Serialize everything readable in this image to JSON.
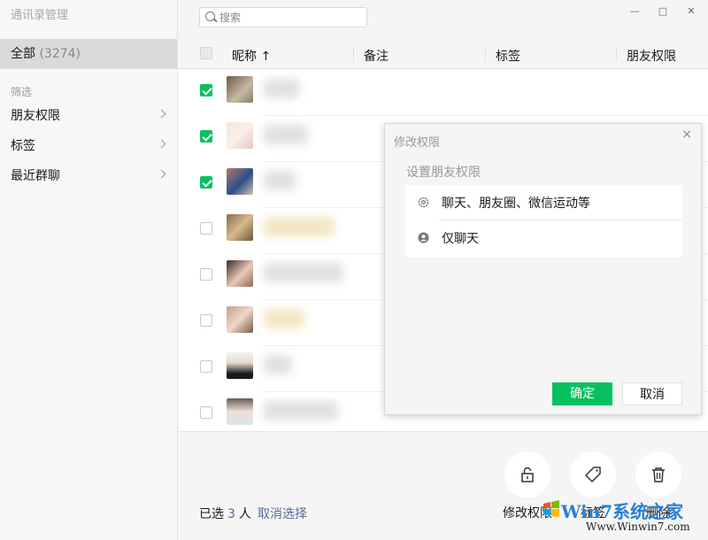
{
  "app": {
    "title": "通讯录管理"
  },
  "sidebar": {
    "all_label": "全部",
    "all_count": "(3274)",
    "section_label": "筛选",
    "items": [
      {
        "label": "朋友权限"
      },
      {
        "label": "标签"
      },
      {
        "label": "最近群聊"
      }
    ]
  },
  "search": {
    "placeholder": "搜索"
  },
  "window": {
    "minimize": "—",
    "maximize": "□",
    "close": "✕"
  },
  "table": {
    "columns": [
      {
        "label": "昵称 ↑"
      },
      {
        "label": "备注"
      },
      {
        "label": "标签"
      },
      {
        "label": "朋友权限"
      }
    ],
    "rows": [
      {
        "checked": true
      },
      {
        "checked": true
      },
      {
        "checked": true
      },
      {
        "checked": false
      },
      {
        "checked": false
      },
      {
        "checked": false
      },
      {
        "checked": false
      },
      {
        "checked": false
      }
    ]
  },
  "footer": {
    "selected_prefix": "已选",
    "selected_count": "3",
    "selected_suffix": "人",
    "cancel_select": "取消选择",
    "actions": [
      {
        "label": "修改权限",
        "icon": "lock-icon"
      },
      {
        "label": "标签",
        "icon": "tag-icon"
      },
      {
        "label": "删除",
        "icon": "trash-icon"
      }
    ]
  },
  "dialog": {
    "title": "修改权限",
    "close": "×",
    "subtitle": "设置朋友权限",
    "options": [
      {
        "label": "聊天、朋友圈、微信运动等",
        "icon": "moments-icon"
      },
      {
        "label": "仅聊天",
        "icon": "chat-only-icon"
      }
    ],
    "ok": "确定",
    "cancel": "取消"
  },
  "watermark": {
    "brand": "Win7系统之家",
    "url": "Www.Winwin7.com"
  },
  "colors": {
    "accent": "#07c160",
    "link": "#576b95"
  }
}
